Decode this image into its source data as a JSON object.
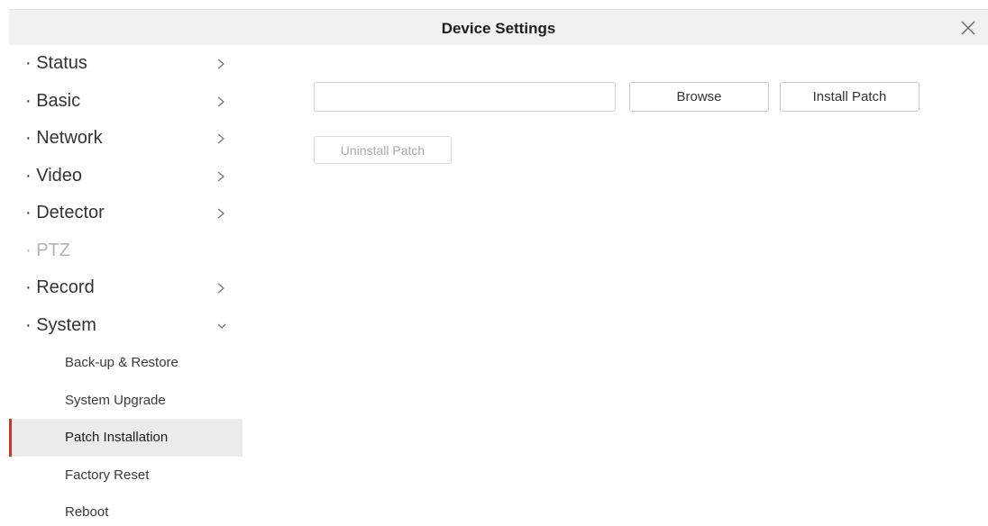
{
  "window": {
    "title": "Device Settings"
  },
  "sidebar": {
    "items": [
      {
        "label": "· Status",
        "chevron": "chevron-right"
      },
      {
        "label": "· Basic",
        "chevron": "chevron-right"
      },
      {
        "label": "· Network",
        "chevron": "chevron-right"
      },
      {
        "label": "· Video",
        "chevron": "chevron-right"
      },
      {
        "label": "· Detector",
        "chevron": "chevron-right"
      },
      {
        "label": "· PTZ",
        "disabled": true
      },
      {
        "label": "· Record",
        "chevron": "chevron-right"
      },
      {
        "label": "· System",
        "chevron": "chevron-down",
        "expanded": true
      }
    ],
    "system_subitems": [
      {
        "label": "Back-up & Restore"
      },
      {
        "label": "System Upgrade"
      },
      {
        "label": "Patch Installation",
        "active": true
      },
      {
        "label": "Factory Reset"
      },
      {
        "label": "Reboot"
      }
    ]
  },
  "patch": {
    "file_value": "",
    "browse_label": "Browse",
    "install_label": "Install Patch",
    "uninstall_label": "Uninstall Patch"
  },
  "colors": {
    "active_indicator": "#c8362f",
    "active_background": "#ebebeb",
    "titlebar_background": "#f1f1f1"
  }
}
